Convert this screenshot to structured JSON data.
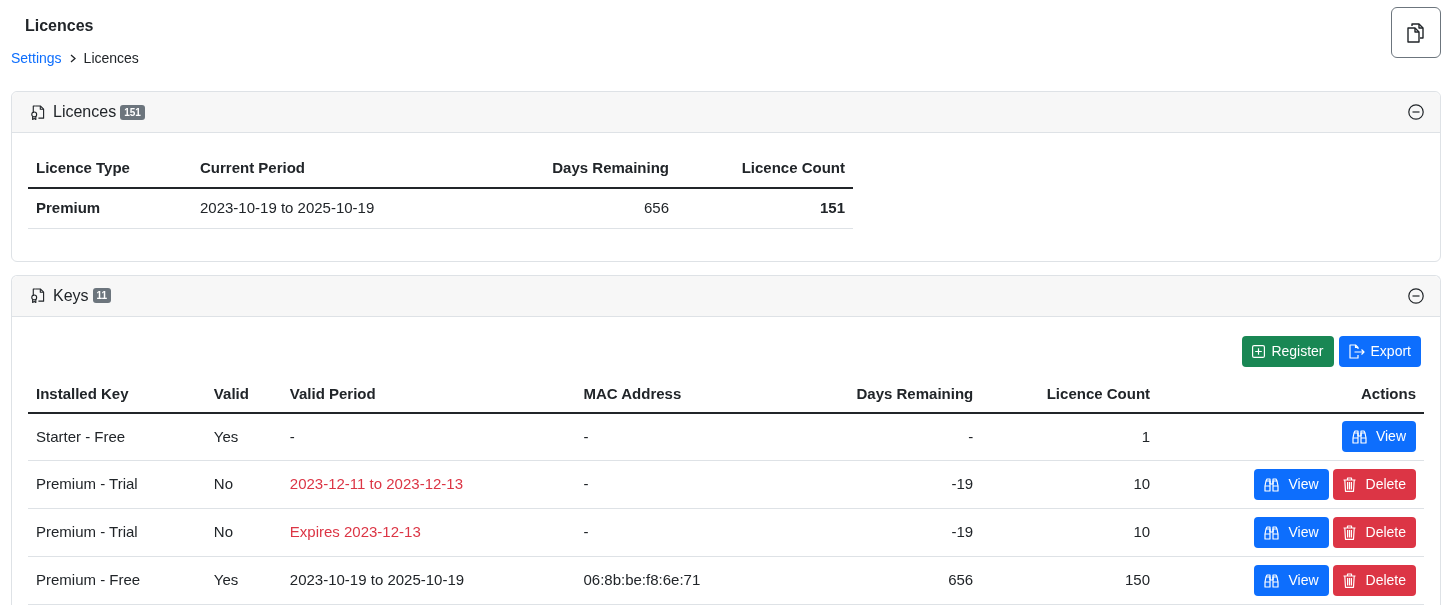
{
  "page": {
    "title": "Licences"
  },
  "breadcrumb": [
    {
      "label": "Settings",
      "kind": "link"
    },
    {
      "label": "Licences",
      "kind": "current"
    }
  ],
  "licences_card": {
    "title": "Licences",
    "badge": "151",
    "expanded": true,
    "table": {
      "columns": [
        "Licence Type",
        "Current Period",
        "Days Remaining",
        "Licence Count"
      ],
      "rows": [
        [
          "Premium",
          "2023-10-19 to 2025-10-19",
          "656",
          "151"
        ]
      ]
    }
  },
  "keys_card": {
    "title": "Keys",
    "badge": "11",
    "expanded": true,
    "toolbar": [
      {
        "kind": "register",
        "label": "Register"
      },
      {
        "kind": "export",
        "label": "Export"
      }
    ],
    "table": {
      "columns": [
        "Installed Key",
        "Valid",
        "Valid Period",
        "MAC Address",
        "Days Remaining",
        "Licence Count",
        "Actions"
      ],
      "rows": [
        {
          "installed_key": "Starter - Free",
          "valid": "Yes",
          "valid_period": "-",
          "period_expired": false,
          "mac_address": "-",
          "days_remaining": "-",
          "licence_count": "1",
          "actions": [
            {
              "kind": "view",
              "label": "View"
            }
          ]
        },
        {
          "installed_key": "Premium - Trial",
          "valid": "No",
          "valid_period": "2023-12-11 to 2023-12-13",
          "period_expired": true,
          "mac_address": "-",
          "days_remaining": "-19",
          "licence_count": "10",
          "actions": [
            {
              "kind": "view",
              "label": "View"
            },
            {
              "kind": "delete",
              "label": "Delete"
            }
          ]
        },
        {
          "installed_key": "Premium - Trial",
          "valid": "No",
          "valid_period": "Expires 2023-12-13",
          "period_expired": true,
          "mac_address": "-",
          "days_remaining": "-19",
          "licence_count": "10",
          "actions": [
            {
              "kind": "view",
              "label": "View"
            },
            {
              "kind": "delete",
              "label": "Delete"
            }
          ]
        },
        {
          "installed_key": "Premium - Free",
          "valid": "Yes",
          "valid_period": "2023-10-19 to 2025-10-19",
          "period_expired": false,
          "mac_address": "06:8b:be:f8:6e:71",
          "days_remaining": "656",
          "licence_count": "150",
          "actions": [
            {
              "kind": "view",
              "label": "View"
            },
            {
              "kind": "delete",
              "label": "Delete"
            }
          ]
        }
      ]
    }
  }
}
